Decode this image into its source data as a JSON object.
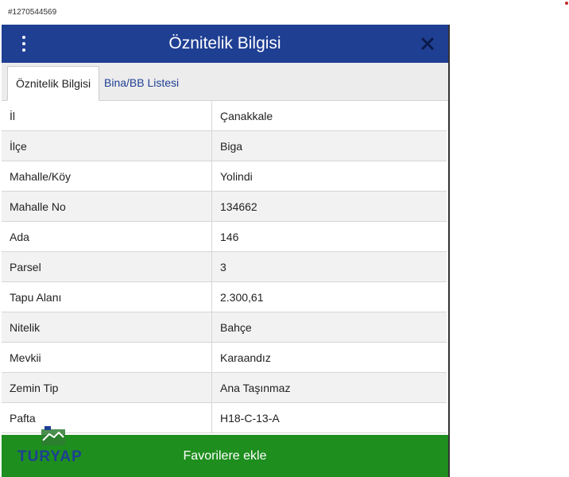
{
  "listing_id": "#1270544569",
  "header": {
    "title": "Öznitelik Bilgisi",
    "menu_icon": "kebab-menu-icon",
    "close_icon": "close-icon"
  },
  "tabs": [
    {
      "label": "Öznitelik Bilgisi",
      "active": true
    },
    {
      "label": "Bina/BB Listesi",
      "active": false
    }
  ],
  "attributes": [
    {
      "key": "İl",
      "value": "Çanakkale"
    },
    {
      "key": "İlçe",
      "value": "Biga"
    },
    {
      "key": "Mahalle/Köy",
      "value": "Yolindi"
    },
    {
      "key": "Mahalle No",
      "value": "134662"
    },
    {
      "key": "Ada",
      "value": "146"
    },
    {
      "key": "Parsel",
      "value": "3"
    },
    {
      "key": "Tapu Alanı",
      "value": "2.300,61"
    },
    {
      "key": "Nitelik",
      "value": "Bahçe"
    },
    {
      "key": "Mevkii",
      "value": "Karaandız"
    },
    {
      "key": "Zemin Tip",
      "value": "Ana Taşınmaz"
    },
    {
      "key": "Pafta",
      "value": "H18-C-13-A"
    }
  ],
  "footer": {
    "button_label": "Favorilere ekle"
  },
  "logo": {
    "text": "TURYAP"
  },
  "colors": {
    "header": "#1f3f93",
    "footer": "#1e8e1e",
    "tab_link": "#1f3f93"
  }
}
